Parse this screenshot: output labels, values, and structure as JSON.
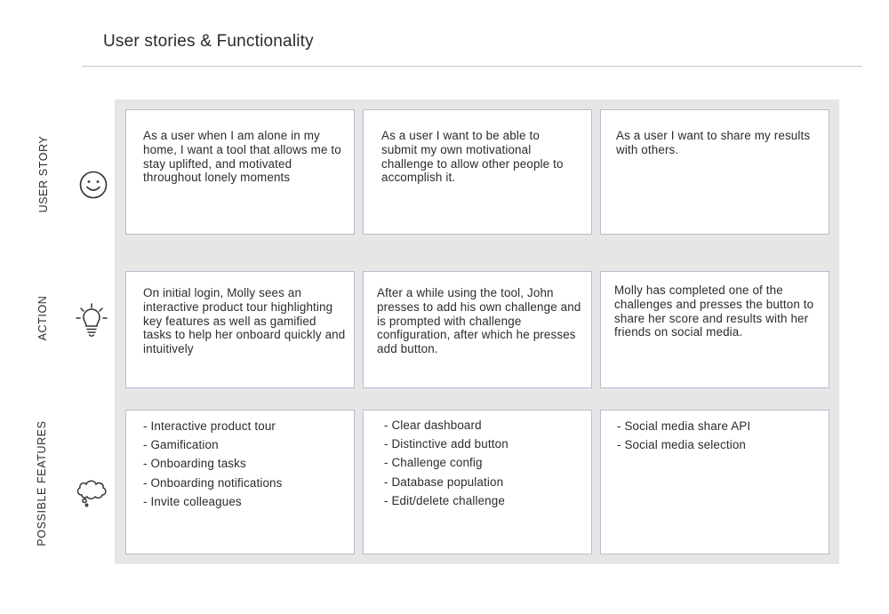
{
  "header": {
    "title": "User stories & Functionality"
  },
  "rows": [
    {
      "label": "USER STORY",
      "icon": "smiley-face-icon",
      "cards": [
        {
          "text": "As a user when I am alone in my home, I want a tool that allows me to stay uplifted,  and motivated throughout lonely moments"
        },
        {
          "text": "As a user I want to be able to submit my own motivational challenge to allow other people to accomplish it."
        },
        {
          "text": "As a user I want to share my results with others."
        }
      ]
    },
    {
      "label": "ACTION",
      "icon": "lightbulb-icon",
      "cards": [
        {
          "text": "On initial login, Molly sees an interactive product tour highlighting key features as well as gamified tasks to help her onboard quickly and intuitively"
        },
        {
          "text": "After a while using the tool, John presses to add his own challenge and is prompted with challenge configuration, after which he presses add button."
        },
        {
          "text": "Molly has completed one of the challenges and presses the button to share her score and results with her friends on social media."
        }
      ]
    },
    {
      "label": "POSSIBLE FEATURES",
      "icon": "thought-cloud-icon",
      "cards": [
        {
          "items": [
            "- Interactive product tour",
            "- Gamification",
            "- Onboarding tasks",
            "- Onboarding notifications",
            "- Invite colleagues"
          ]
        },
        {
          "items": [
            "- Clear dashboard",
            "- Distinctive add button",
            "- Challenge config",
            "- Database population",
            "- Edit/delete challenge"
          ]
        },
        {
          "items": [
            "- Social media share API",
            "- Social media selection"
          ]
        }
      ]
    }
  ]
}
